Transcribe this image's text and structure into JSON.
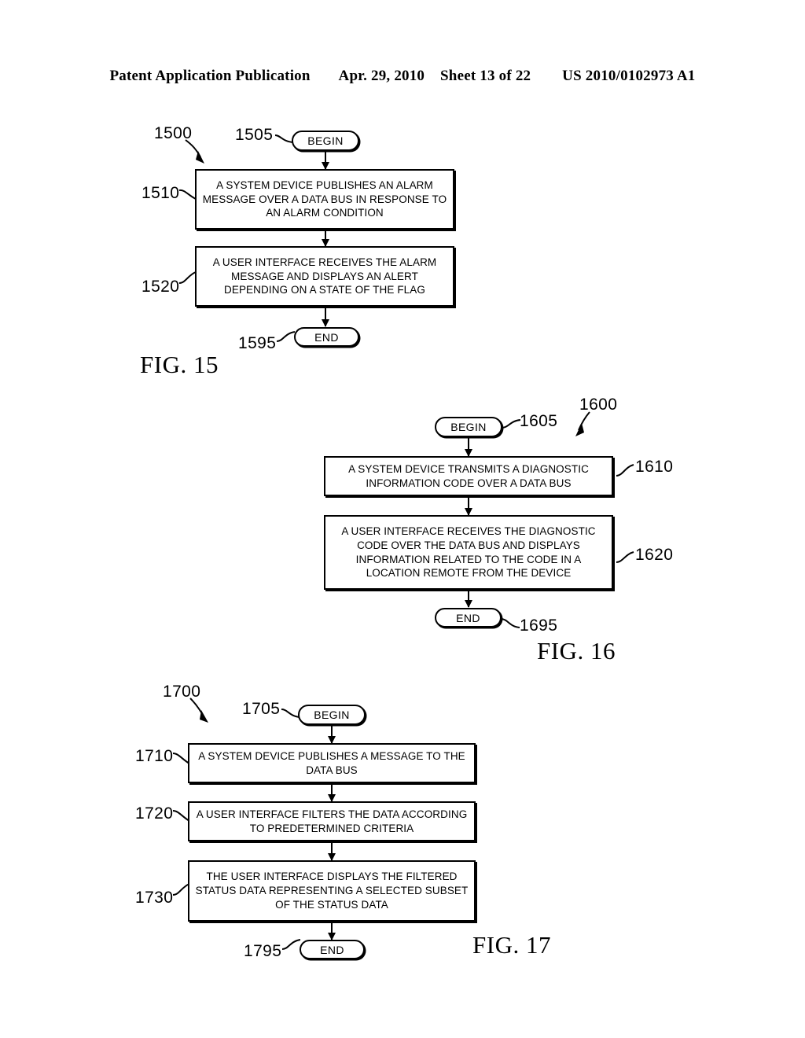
{
  "header": {
    "publication": "Patent Application Publication",
    "date": "Apr. 29, 2010",
    "sheet": "Sheet 13 of 22",
    "patent_number": "US 2010/0102973 A1"
  },
  "figures": [
    {
      "id": "fig-15",
      "label": "FIG. 15",
      "flow_ref": "1500",
      "nodes": [
        {
          "ref": "1505",
          "type": "terminal",
          "text": "BEGIN"
        },
        {
          "ref": "1510",
          "type": "process",
          "text": "A SYSTEM DEVICE PUBLISHES AN ALARM MESSAGE OVER A DATA BUS IN RESPONSE TO AN ALARM CONDITION"
        },
        {
          "ref": "1520",
          "type": "process",
          "text": "A USER INTERFACE RECEIVES THE ALARM MESSAGE AND DISPLAYS AN ALERT DEPENDING ON A STATE OF THE FLAG"
        },
        {
          "ref": "1595",
          "type": "terminal",
          "text": "END"
        }
      ]
    },
    {
      "id": "fig-16",
      "label": "FIG. 16",
      "flow_ref": "1600",
      "nodes": [
        {
          "ref": "1605",
          "type": "terminal",
          "text": "BEGIN"
        },
        {
          "ref": "1610",
          "type": "process",
          "text": "A SYSTEM DEVICE TRANSMITS A DIAGNOSTIC INFORMATION CODE OVER A DATA BUS"
        },
        {
          "ref": "1620",
          "type": "process",
          "text": "A USER INTERFACE RECEIVES THE DIAGNOSTIC CODE OVER THE DATA BUS AND DISPLAYS INFORMATION RELATED TO THE CODE IN A LOCATION REMOTE FROM THE DEVICE"
        },
        {
          "ref": "1695",
          "type": "terminal",
          "text": "END"
        }
      ]
    },
    {
      "id": "fig-17",
      "label": "FIG. 17",
      "flow_ref": "1700",
      "nodes": [
        {
          "ref": "1705",
          "type": "terminal",
          "text": "BEGIN"
        },
        {
          "ref": "1710",
          "type": "process",
          "text": "A SYSTEM DEVICE PUBLISHES A MESSAGE TO THE DATA BUS"
        },
        {
          "ref": "1720",
          "type": "process",
          "text": "A USER INTERFACE FILTERS THE DATA ACCORDING TO PREDETERMINED CRITERIA"
        },
        {
          "ref": "1730",
          "type": "process",
          "text": "THE USER INTERFACE DISPLAYS THE FILTERED STATUS DATA REPRESENTING A SELECTED SUBSET OF THE STATUS DATA"
        },
        {
          "ref": "1795",
          "type": "terminal",
          "text": "END"
        }
      ]
    }
  ],
  "colors": {
    "ink": "#000000",
    "paper": "#ffffff"
  }
}
